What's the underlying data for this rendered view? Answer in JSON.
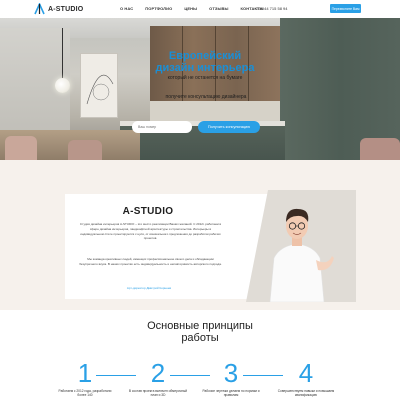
{
  "header": {
    "logo_text": "A-STUDIO",
    "nav": [
      "О НАС",
      "ПОРТФОЛИО",
      "ЦЕНЫ",
      "ОТЗЫВЫ",
      "КОНТАКТЫ"
    ],
    "phone": "+375 44 715 58 94",
    "callback_label": "Перезвоните Вам"
  },
  "hero": {
    "title": "Европейский дизайн интерьера",
    "subtitle": "который не останется на бумаге",
    "cta_label": "получите консультацию дизайнера",
    "input_placeholder": "Ваш номер",
    "button_label": "Получить консультацию"
  },
  "about": {
    "title": "A-STUDIO",
    "paragraph1": "Студия дизайна интерьеров A-STUDIO – это место реализации Ваших желаний. С 2012г. работаем в сфере дизайна интерьеров, ландшафтной архитектуры и строительства. Интерьеры в индивидуальном стиле проектируются с нуля, от изначального предложения до разработки рабочих проектов.",
    "paragraph2": "Мы команда креативных людей, имеющих профессиональное своего дела и обладающим безупречного вкуса. В наших проектах есть индивидуальность и неповторимость авторского подхода.",
    "signature": "Арт-директор Дмитрий Корнеев"
  },
  "principles": {
    "title": "Основные принципы работы",
    "items": [
      {
        "number": "1",
        "text": "Работаем с 2012 года, разработали более 140"
      },
      {
        "number": "2",
        "text": "В состав проекта включен обмерочный план и 3D"
      },
      {
        "number": "3",
        "text": "Рабочие чертежи делаем по нормам и правилам"
      },
      {
        "number": "4",
        "text": "Совершенствуем навыки и повышаем квалификацию"
      }
    ]
  },
  "colors": {
    "accent": "#2aa0e6",
    "about_bg": "#f6f1ec"
  }
}
